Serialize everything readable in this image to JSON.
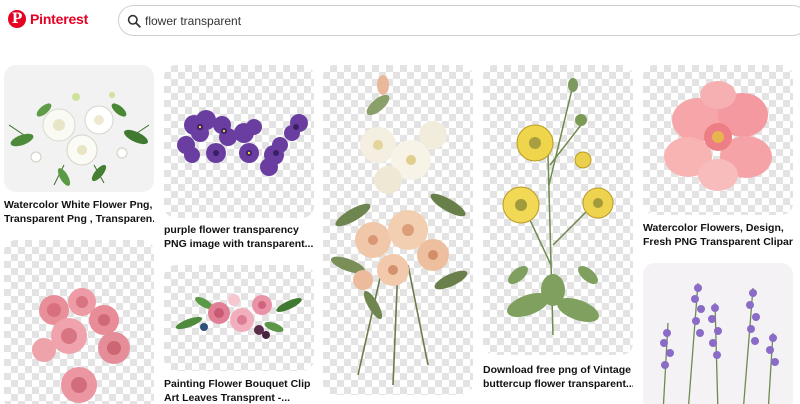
{
  "app": {
    "brand": "Pinterest"
  },
  "search": {
    "value": "flower transparent"
  },
  "pins": [
    {
      "line1": "Watercolor White Flower Png,",
      "line2": "Transparent Png , Transparen..."
    },
    {
      "line1": "purple flower transparency",
      "line2": "PNG image with transparent..."
    },
    {
      "line1": "Painting Flower Bouquet Clip",
      "line2": "Art Leaves Transprent -..."
    },
    {
      "line1": "Download free png of Vintage",
      "line2": "buttercup flower transparent..."
    },
    {
      "line1": "Watercolor Flowers, Design,",
      "line2": "Fresh PNG Transparent Clipar..."
    }
  ],
  "icons": {
    "logo": "pinterest-logo",
    "search": "search-icon"
  },
  "colors": {
    "brand": "#e60023",
    "checker": "#e3e3e3"
  }
}
